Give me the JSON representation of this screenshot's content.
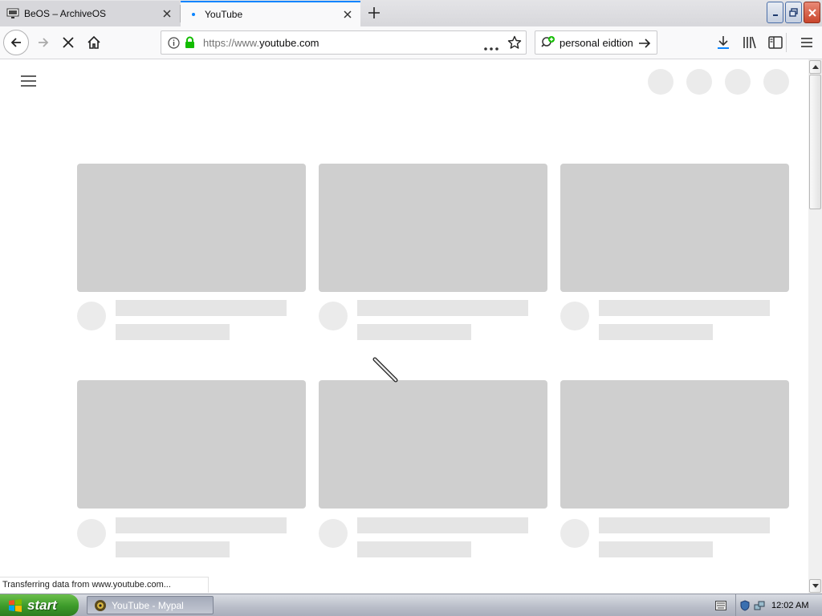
{
  "tabs": [
    {
      "title": "BeOS – ArchiveOS",
      "icon": "monitor-icon",
      "active": false
    },
    {
      "title": "YouTube",
      "icon": "loading-dot-icon",
      "active": true
    }
  ],
  "navbar": {
    "url_prefix": "https://www.",
    "url_host": "youtube.com",
    "search_text": "personal eidtion"
  },
  "status_text": "Transferring data from www.youtube.com...",
  "taskbar": {
    "start_label": "start",
    "task_item": "YouTube - Mypal",
    "clock": "12:02 AM"
  },
  "colors": {
    "active_tab_accent": "#0a84ff",
    "skeleton_thumb": "#cfcfcf",
    "skeleton_line": "#e5e5e5",
    "start_green": "#3c9a2a"
  }
}
